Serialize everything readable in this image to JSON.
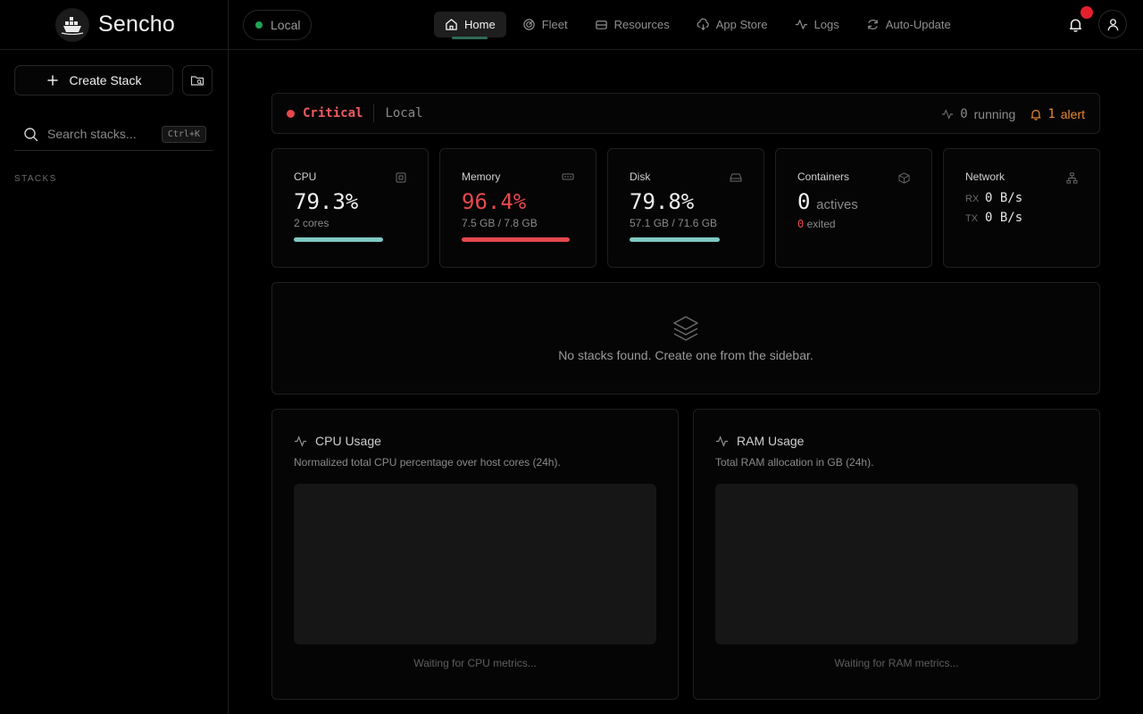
{
  "app": {
    "name": "Sencho"
  },
  "sidebar": {
    "create_label": "Create Stack",
    "search_placeholder": "Search stacks...",
    "shortcut": "Ctrl+K",
    "section_label": "STACKS"
  },
  "topbar": {
    "node_label": "Local",
    "nav": [
      {
        "label": "Home",
        "icon": "home-icon",
        "active": true
      },
      {
        "label": "Fleet",
        "icon": "fleet-icon"
      },
      {
        "label": "Resources",
        "icon": "resources-icon"
      },
      {
        "label": "App Store",
        "icon": "app-store-icon"
      },
      {
        "label": "Logs",
        "icon": "logs-icon"
      },
      {
        "label": "Auto-Update",
        "icon": "auto-update-icon"
      }
    ]
  },
  "status": {
    "level": "Critical",
    "host": "Local",
    "running_count": "0",
    "running_label": "running",
    "alert_count": "1",
    "alert_label": "alert"
  },
  "cards": {
    "cpu": {
      "title": "CPU",
      "value": "79.3%",
      "sub": "2 cores",
      "fraction": 0.793
    },
    "memory": {
      "title": "Memory",
      "value": "96.4%",
      "sub": "7.5 GB / 7.8 GB",
      "fraction": 0.964
    },
    "disk": {
      "title": "Disk",
      "value": "79.8%",
      "sub": "57.1 GB / 71.6 GB",
      "fraction": 0.798
    },
    "containers": {
      "title": "Containers",
      "value": "0",
      "value_suffix": "actives",
      "exited_count": "0",
      "exited_label": "exited"
    },
    "network": {
      "title": "Network",
      "rx_label": "RX",
      "rx_value": "0 B/s",
      "tx_label": "TX",
      "tx_value": "0 B/s"
    }
  },
  "empty_state": {
    "text": "No stacks found. Create one from the sidebar."
  },
  "charts": {
    "cpu": {
      "title": "CPU Usage",
      "subtitle": "Normalized total CPU percentage over host cores (24h).",
      "waiting": "Waiting for CPU metrics..."
    },
    "ram": {
      "title": "RAM Usage",
      "subtitle": "Total RAM allocation in GB (24h).",
      "waiting": "Waiting for RAM metrics..."
    }
  },
  "colors": {
    "accent": "#7fc8c4",
    "danger": "#e5484d",
    "warning": "#ec8a2a",
    "online": "#22a355"
  }
}
